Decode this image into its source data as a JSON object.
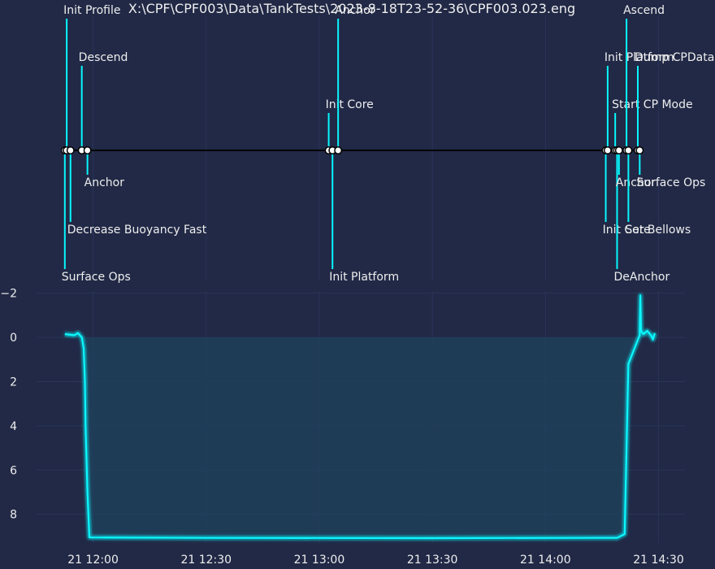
{
  "chart_data": [
    {
      "type": "timeline",
      "title": "X:\\CPF\\CPF003\\Data\\TankTests\\2023-8-18T23-52-36\\CPF003.023.eng",
      "events": [
        {
          "t": "11:52:30",
          "label": "Surface Ops",
          "side": "below",
          "level": 3
        },
        {
          "t": "11:53:00",
          "label": "Init Profile",
          "side": "above",
          "level": 3
        },
        {
          "t": "11:54:00",
          "label": "Decrease Buoyancy Fast",
          "side": "below",
          "level": 2
        },
        {
          "t": "11:57:00",
          "label": "Descend",
          "side": "above",
          "level": 2
        },
        {
          "t": "11:58:30",
          "label": "Anchor",
          "side": "below",
          "level": 1
        },
        {
          "t": "13:02:30",
          "label": "Init Core",
          "side": "above",
          "level": 1
        },
        {
          "t": "13:03:30",
          "label": "Init Platform",
          "side": "below",
          "level": 3
        },
        {
          "t": "13:05:00",
          "label": "Anchor",
          "side": "above",
          "level": 3
        },
        {
          "t": "14:16:00",
          "label": "Init Core",
          "side": "below",
          "level": 2
        },
        {
          "t": "14:16:30",
          "label": "Init Platform",
          "side": "above",
          "level": 2
        },
        {
          "t": "14:18:30",
          "label": "Start CP Mode",
          "side": "above",
          "level": 1
        },
        {
          "t": "14:19:00",
          "label": "DeAnchor",
          "side": "below",
          "level": 3
        },
        {
          "t": "14:19:30",
          "label": "Anchor",
          "side": "below",
          "level": 1
        },
        {
          "t": "14:21:30",
          "label": "Ascend",
          "side": "above",
          "level": 3
        },
        {
          "t": "14:22:00",
          "label": "Set Bellows",
          "side": "below",
          "level": 2
        },
        {
          "t": "14:24:30",
          "label": "Dump CPData",
          "side": "above",
          "level": 2
        },
        {
          "t": "14:25:00",
          "label": "Surface Ops",
          "side": "below",
          "level": 1
        }
      ]
    },
    {
      "type": "line",
      "series": [
        {
          "values": [
            [
              "11:52:30",
              -0.15
            ],
            [
              "11:55:00",
              -0.1
            ],
            [
              "11:56:00",
              -0.2
            ],
            [
              "11:57:00",
              0.0
            ],
            [
              "11:57:30",
              0.5
            ],
            [
              "11:57:50",
              2.0
            ],
            [
              "11:58:00",
              4.0
            ],
            [
              "11:58:30",
              7.0
            ],
            [
              "11:59:00",
              9.05
            ],
            [
              "12:30:00",
              9.07
            ],
            [
              "13:30:00",
              9.08
            ],
            [
              "14:12:00",
              9.07
            ],
            [
              "14:19:00",
              9.07
            ],
            [
              "14:21:00",
              8.9
            ],
            [
              "14:22:00",
              1.2
            ],
            [
              "14:25:00",
              -0.1
            ],
            [
              "14:25:10",
              -1.9
            ],
            [
              "14:25:20",
              -0.3
            ],
            [
              "14:26:00",
              -0.15
            ],
            [
              "14:27:00",
              -0.3
            ],
            [
              "14:28:00",
              -0.1
            ],
            [
              "14:28:30",
              0.1
            ],
            [
              "14:29:00",
              -0.2
            ]
          ]
        }
      ],
      "xlabel": "",
      "ylabel": "",
      "xticks": [
        "21 12:00",
        "21 12:30",
        "21 13:00",
        "21 13:30",
        "21 14:00",
        "21 14:30"
      ],
      "yticks": [
        "−2",
        "0",
        "2",
        "4",
        "6",
        "8"
      ],
      "xlim": [
        "11:45",
        "14:37"
      ],
      "ylim": [
        9.3,
        -2.1
      ],
      "y_inverted": true,
      "grid": true,
      "fill_to_zero": true
    }
  ],
  "colors": {
    "background": "#212946",
    "grid": "#2A3459",
    "accent": "#08F7FE",
    "text": "#EEEEEE",
    "fill": "#1F3F5B",
    "baseline": "#000000",
    "marker_fill": "#FFFFFF"
  }
}
